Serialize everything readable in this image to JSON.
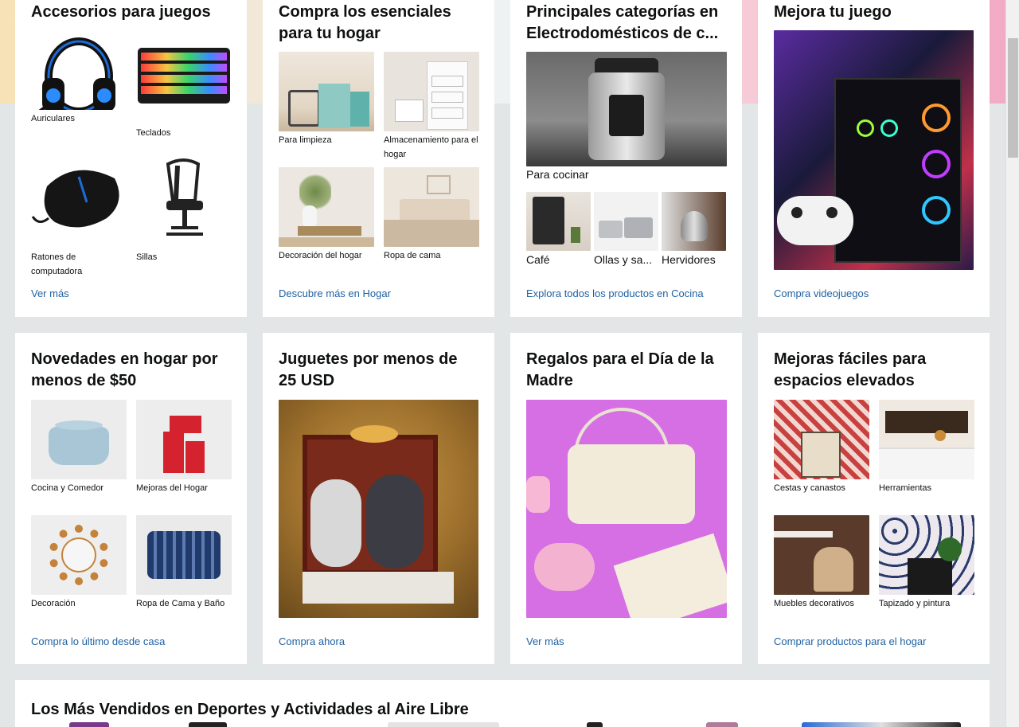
{
  "cards_row1": [
    {
      "title": "Accesorios para juegos",
      "tiles": [
        {
          "label": "Auriculares",
          "icon": "headset-icon"
        },
        {
          "label": "Teclados",
          "icon": "keyboard-icon"
        },
        {
          "label": "Ratones de computadora",
          "icon": "mouse-icon"
        },
        {
          "label": "Sillas",
          "icon": "chair-icon"
        }
      ],
      "link": "Ver más"
    },
    {
      "title": "Compra los esenciales para tu hogar",
      "tiles": [
        {
          "label": "Para limpieza"
        },
        {
          "label": "Almacenamiento para el hogar"
        },
        {
          "label": "Decoración del hogar"
        },
        {
          "label": "Ropa de cama"
        }
      ],
      "link": "Descubre más en Hogar"
    },
    {
      "title": "Principales categorías en Electrodomésticos de c...",
      "main_label": "Para cocinar",
      "small": [
        {
          "label": "Café"
        },
        {
          "label": "Ollas y sa..."
        },
        {
          "label": "Hervidores"
        }
      ],
      "link": "Explora todos los productos en Cocina"
    },
    {
      "title": "Mejora tu juego",
      "link": "Compra videojuegos"
    }
  ],
  "cards_row2": [
    {
      "title": "Novedades en hogar por menos de $50",
      "tiles": [
        {
          "label": "Cocina y Comedor"
        },
        {
          "label": "Mejoras del Hogar"
        },
        {
          "label": "Decoración"
        },
        {
          "label": "Ropa de Cama y Baño"
        }
      ],
      "link": "Compra lo último desde casa"
    },
    {
      "title": "Juguetes por menos de 25 USD",
      "link": "Compra ahora"
    },
    {
      "title": "Regalos para el Día de la Madre",
      "link": "Ver más"
    },
    {
      "title": "Mejoras fáciles para espacios elevados",
      "tiles": [
        {
          "label": "Cestas y canastos"
        },
        {
          "label": "Herramientas"
        },
        {
          "label": "Muebles decorativos"
        },
        {
          "label": "Tapizado y pintura"
        }
      ],
      "link": "Comprar productos para el hogar"
    }
  ],
  "bestsellers": {
    "title": "Los Más Vendidos en Deportes y Actividades al Aire Libre"
  }
}
